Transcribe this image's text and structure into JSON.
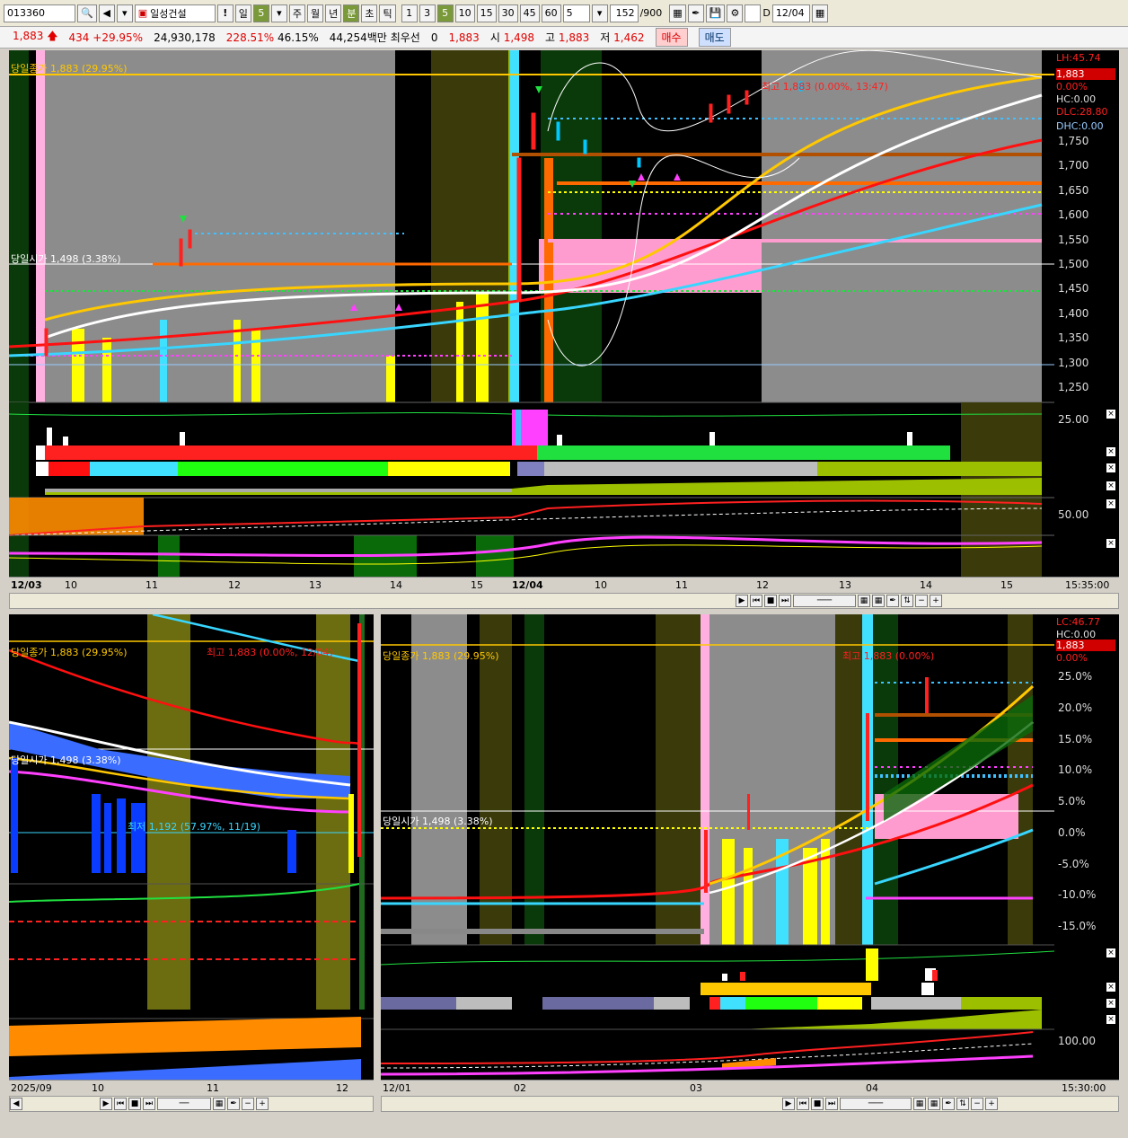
{
  "toolbar": {
    "code": "013360",
    "name": "일성건설",
    "period_day": "일",
    "period_day_n": "5",
    "periods": [
      "주",
      "월",
      "년",
      "분",
      "초",
      "틱"
    ],
    "minutes": [
      "1",
      "3",
      "5",
      "10",
      "15",
      "30",
      "45",
      "60"
    ],
    "minute_sel": "5",
    "count": "152",
    "count_max": "/900",
    "date_check": "D",
    "date": "12/04"
  },
  "quote": {
    "price": "1,883",
    "change": "434",
    "change_pct": "+29.95%",
    "volume": "24,930,178",
    "vol_ratio": "228.51%",
    "ratio2": "46.15%",
    "amount": "44,254백만",
    "best_label": "최우선",
    "best_val": "0",
    "best_price": "1,883",
    "open_label": "시",
    "open": "1,498",
    "high_label": "고",
    "high": "1,883",
    "low_label": "저",
    "low": "1,462",
    "buy": "매수",
    "sell": "매도"
  },
  "main_chart": {
    "close_label": "당일종가 1,883 (29.95%)",
    "open_label": "당일시가 1,498 (3.38%)",
    "high_marker": "최고 1,883 (0.00%, 13:47)",
    "right_lh": "LH:45.74",
    "right_price": "1,883",
    "right_pct": "0.00%",
    "right_hc": "HC:0.00",
    "right_dlc": "DLC:28.80",
    "right_dhc": "DHC:0.00",
    "y_ticks": [
      "1,750",
      "1,700",
      "1,650",
      "1,600",
      "1,550",
      "1,500",
      "1,450",
      "1,400",
      "1,350",
      "1,300",
      "1,250"
    ],
    "sub_tick1": "25.00",
    "sub_tick2": "50.00",
    "x_labels": [
      "12/03",
      "10",
      "11",
      "12",
      "13",
      "14",
      "15",
      "12/04",
      "10",
      "11",
      "12",
      "13",
      "14",
      "15"
    ],
    "time": "15:35:00"
  },
  "left_chart": {
    "close_label": "당일종가 1,883 (29.95%)",
    "high_marker": "최고 1,883 (0.00%, 12/04)",
    "open_label": "당일시가 1,498 (3.38%)",
    "low_marker": "최저 1,192 (57.97%, 11/19)",
    "x_labels": [
      "2025/09",
      "10",
      "11",
      "12"
    ]
  },
  "right_chart": {
    "lc": "LC:46.77",
    "hc": "HC:0.00",
    "price": "1,883",
    "pct": "0.00%",
    "close_label": "당일종가 1,883 (29.95%)",
    "high_marker": "최고 1,883 (0.00%)",
    "open_label": "당일시가 1,498 (3.38%)",
    "y_ticks": [
      "25.0%",
      "20.0%",
      "15.0%",
      "10.0%",
      "5.0%",
      "0.0%",
      "-5.0%",
      "-10.0%",
      "-15.0%"
    ],
    "sub_tick": "100.00",
    "x_labels": [
      "12/01",
      "02",
      "03",
      "04"
    ],
    "time": "15:30:00"
  },
  "colors": {
    "bg": "#000000",
    "up": "#ff2020",
    "down": "#00c8ff",
    "ma_yellow": "#ffd800",
    "ma_red": "#ff1010",
    "ma_white": "#ffffff",
    "ma_cyan": "#38d6ff"
  }
}
